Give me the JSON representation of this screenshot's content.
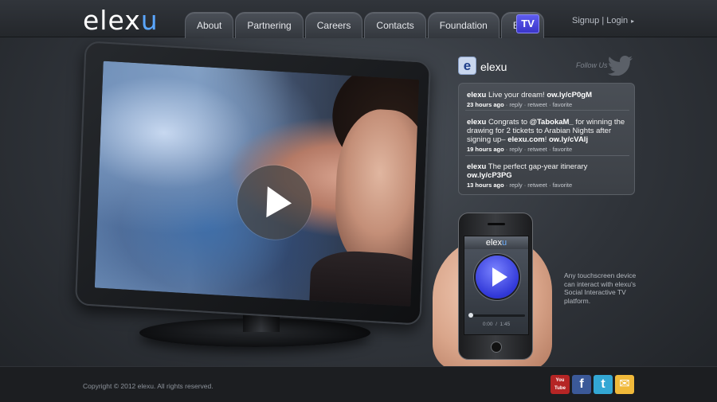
{
  "header": {
    "logo_main": "elex",
    "logo_accent": "u",
    "nav": [
      "About",
      "Partnering",
      "Careers",
      "Contacts",
      "Foundation",
      "Blog"
    ],
    "tv_badge": "TV",
    "signup": "Signup",
    "separator": "|",
    "login": "Login",
    "arrow": "▸"
  },
  "twitter": {
    "avatar_letter": "e",
    "name": "elexu",
    "follow_label": "Follow Us",
    "tweets": [
      {
        "user": "elexu",
        "text": "Live your dream! ",
        "link": "ow.ly/cP0gM",
        "time": "23 hours ago",
        "reply": "reply",
        "retweet": "retweet",
        "favorite": "favorite"
      },
      {
        "user": "elexu",
        "text_1": "Congrats to ",
        "mention": "@TabokaM_",
        "text_2": " for winning the drawing for 2 tickets to Arabian Nights after signing up– ",
        "domain": "elexu.com",
        "text_3": "! ",
        "link": "ow.ly/cVAlj",
        "time": "19 hours ago",
        "reply": "reply",
        "retweet": "retweet",
        "favorite": "favorite"
      },
      {
        "user": "elexu",
        "text": "The perfect gap-year itinerary ",
        "link": "ow.ly/cP3PG",
        "time": "13 hours ago",
        "reply": "reply",
        "retweet": "retweet",
        "favorite": "favorite"
      }
    ]
  },
  "phone": {
    "app_main": "elex",
    "app_accent": "u",
    "time_elapsed": "0:00",
    "time_sep": "/",
    "time_total": "1:45",
    "progress_fraction": 0.0,
    "caption": "Any touchscreen device can interact with elexu's Social Interactive TV platform."
  },
  "footer": {
    "copyright": "Copyright © 2012 elexu. All rights reserved.",
    "social": [
      {
        "icon": "youtube-icon",
        "label": "You Tube"
      },
      {
        "icon": "facebook-icon",
        "label": "f"
      },
      {
        "icon": "twitter-icon",
        "label": "t"
      },
      {
        "icon": "mail-icon",
        "label": "✉"
      }
    ]
  },
  "colors": {
    "accent": "#5aa6ff",
    "tv_badge": "#4b47e0"
  }
}
